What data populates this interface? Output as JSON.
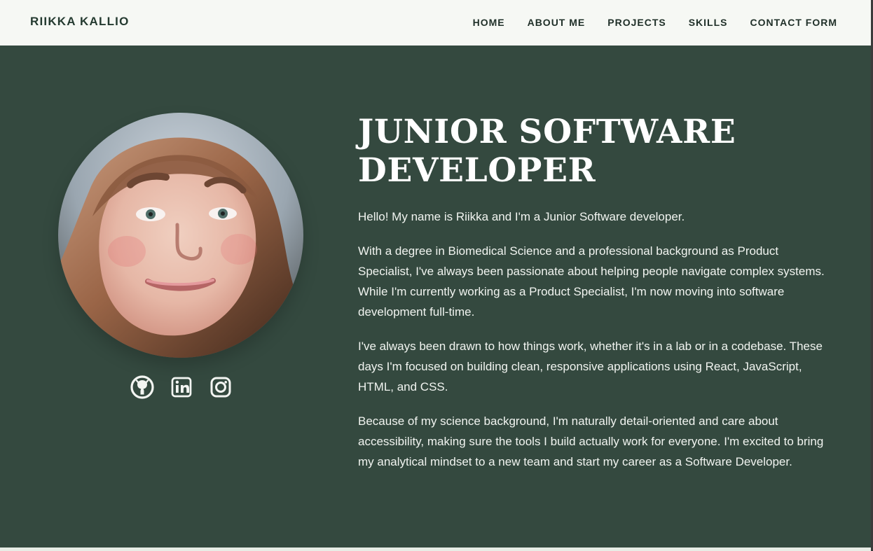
{
  "header": {
    "brand": "RIIKKA KALLIO",
    "nav": [
      {
        "label": "HOME"
      },
      {
        "label": "ABOUT ME"
      },
      {
        "label": "PROJECTS"
      },
      {
        "label": "SKILLS"
      },
      {
        "label": "CONTACT FORM"
      }
    ]
  },
  "hero": {
    "title": "JUNIOR SOFTWARE DEVELOPER",
    "paragraphs": [
      "Hello! My name is Riikka and I'm a Junior Software developer.",
      "With a degree in Biomedical Science and a professional background as Product Specialist, I've always been passionate about helping people navigate complex systems. While I'm currently working as a Product Specialist, I'm now moving into software development full-time.",
      "I've always been drawn to how things work, whether it's in a lab or in a codebase. These days I'm focused on building clean, responsive applications using React, JavaScript, HTML, and CSS.",
      "Because of my science background, I'm naturally detail-oriented and care about accessibility, making sure the tools I build actually work for everyone. I'm excited to bring my analytical mindset to a new team and start my career as a Software Developer."
    ]
  },
  "socials": [
    {
      "icon": "github-icon"
    },
    {
      "icon": "linkedin-icon"
    },
    {
      "icon": "instagram-icon"
    }
  ],
  "colors": {
    "header_bg": "#f6f8f4",
    "hero_bg": "#34493f",
    "brand_text": "#243a30",
    "nav_text": "#1f2f28",
    "hero_text": "#f1f4f0",
    "title_text": "#ffffff"
  }
}
